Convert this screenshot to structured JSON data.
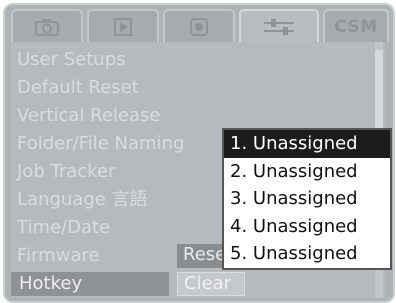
{
  "tabs": [
    {
      "icon": "camera-icon",
      "active": false
    },
    {
      "icon": "play-icon",
      "active": false
    },
    {
      "icon": "record-icon",
      "active": false
    },
    {
      "icon": "settings-sliders-icon",
      "active": true
    },
    {
      "label": "CSM",
      "active": false
    }
  ],
  "menu": {
    "items": [
      "User Setups",
      "Default Reset",
      "Vertical Release",
      "Folder/File Naming",
      "Job Tracker",
      "Language 言語",
      "Time/Date",
      "Firmware",
      "Hotkey"
    ],
    "highlighted_index": 8
  },
  "buttons": {
    "reset_label": "Reset",
    "clear_label": "Clear"
  },
  "popup": {
    "options": [
      "1. Unassigned",
      "2. Unassigned",
      "3. Unassigned",
      "4. Unassigned",
      "5. Unassigned"
    ],
    "selected_index": 0
  },
  "colors": {
    "background": "#aeb3b6",
    "highlight": "#8f9295",
    "popup_selected": "#1c1c1c"
  }
}
